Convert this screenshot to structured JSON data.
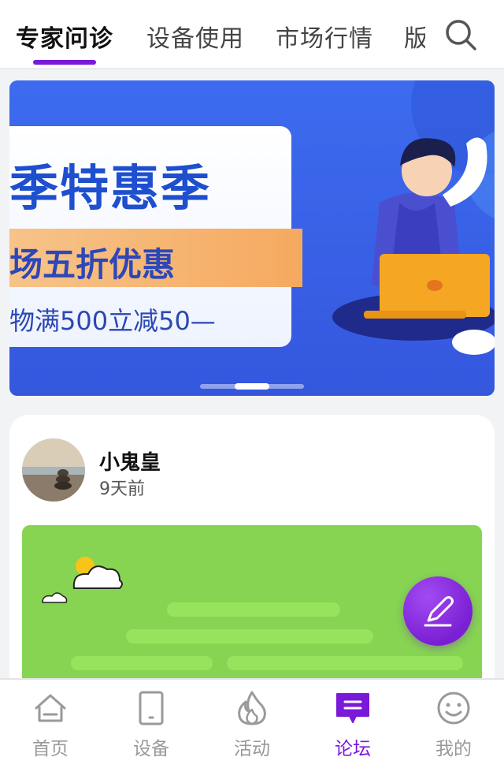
{
  "top_tabs": {
    "items": [
      {
        "label": "专家问诊",
        "active": true
      },
      {
        "label": "设备使用",
        "active": false
      },
      {
        "label": "市场行情",
        "active": false
      },
      {
        "label": "版",
        "active": false
      }
    ],
    "search_icon": "search-icon"
  },
  "banner": {
    "title": "季特惠季",
    "subtitle": "场五折优惠",
    "line": "物满500立减50—",
    "slides_total": 3,
    "slide_active": 2
  },
  "post": {
    "author": "小鬼皇",
    "time": "9天前"
  },
  "fab": {
    "icon": "edit-pen-icon"
  },
  "bottom_nav": {
    "items": [
      {
        "label": "首页",
        "icon": "home-icon"
      },
      {
        "label": "设备",
        "icon": "tablet-icon"
      },
      {
        "label": "活动",
        "icon": "flame-icon"
      },
      {
        "label": "论坛",
        "icon": "chat-icon",
        "active": true
      },
      {
        "label": "我的",
        "icon": "smile-icon"
      }
    ]
  },
  "colors": {
    "accent": "#7a19d8",
    "banner_bg": "#3d6bef",
    "post_image_bg": "#86d452"
  }
}
